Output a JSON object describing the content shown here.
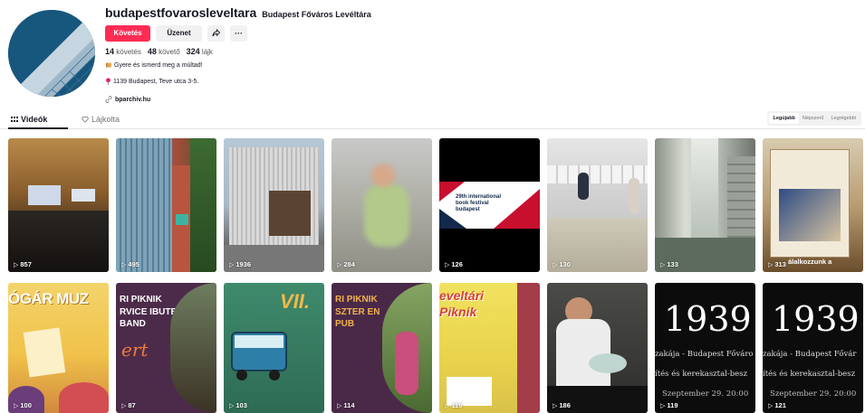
{
  "profile": {
    "username": "budapestfovarosleveltara",
    "nickname": "Budapest Főváros Levéltára",
    "follow_label": "Követés",
    "message_label": "Üzenet",
    "more_label": "···",
    "stats": [
      {
        "value": "14",
        "label": "követés"
      },
      {
        "value": "48",
        "label": "követő"
      },
      {
        "value": "324",
        "label": "lájk"
      }
    ],
    "bio_line": "Gyere és ismerd meg a múltad!",
    "address": "1139 Budapest, Teve utca 3-5.",
    "link": "bparchiv.hu"
  },
  "tabs": {
    "videos": "Videók",
    "liked": "Lájkolta"
  },
  "sort": {
    "options": [
      "Legújabb",
      "Népszerű",
      "Legrégebbi"
    ],
    "active": "Legújabb"
  },
  "videos": [
    {
      "views": "857"
    },
    {
      "views": "495"
    },
    {
      "views": "1936"
    },
    {
      "views": "284"
    },
    {
      "views": "126",
      "caption": "29th international book festival budapest"
    },
    {
      "views": "130"
    },
    {
      "views": "133"
    },
    {
      "views": "313",
      "caption": "álalkozzunk a"
    },
    {
      "views": "100",
      "caption": "ÓGÁR MUZ"
    },
    {
      "views": "87",
      "caption": "RI PIKNIK RVICE IBUTE BAND"
    },
    {
      "views": "103",
      "caption": "VII."
    },
    {
      "views": "114",
      "caption": "RI PIKNIK SZTER EN PUB"
    },
    {
      "views": "119",
      "caption": "eveltári Piknik"
    },
    {
      "views": "186"
    },
    {
      "views": "119",
      "caption": "1939",
      "subcaption": "zakája - Budapest Főváro",
      "subcaption2": "ítés és kerekasztal-besz",
      "date": "Szeptember 29. 20:00"
    },
    {
      "views": "121",
      "caption": "1939",
      "subcaption": "zakája - Budapest Fővár",
      "subcaption2": "ítés és kerekasztal-besz",
      "date": "Szeptember 29. 20:00"
    }
  ],
  "colors": {
    "accent": "#fe2c55",
    "text": "#161823",
    "muted": "#757575"
  }
}
